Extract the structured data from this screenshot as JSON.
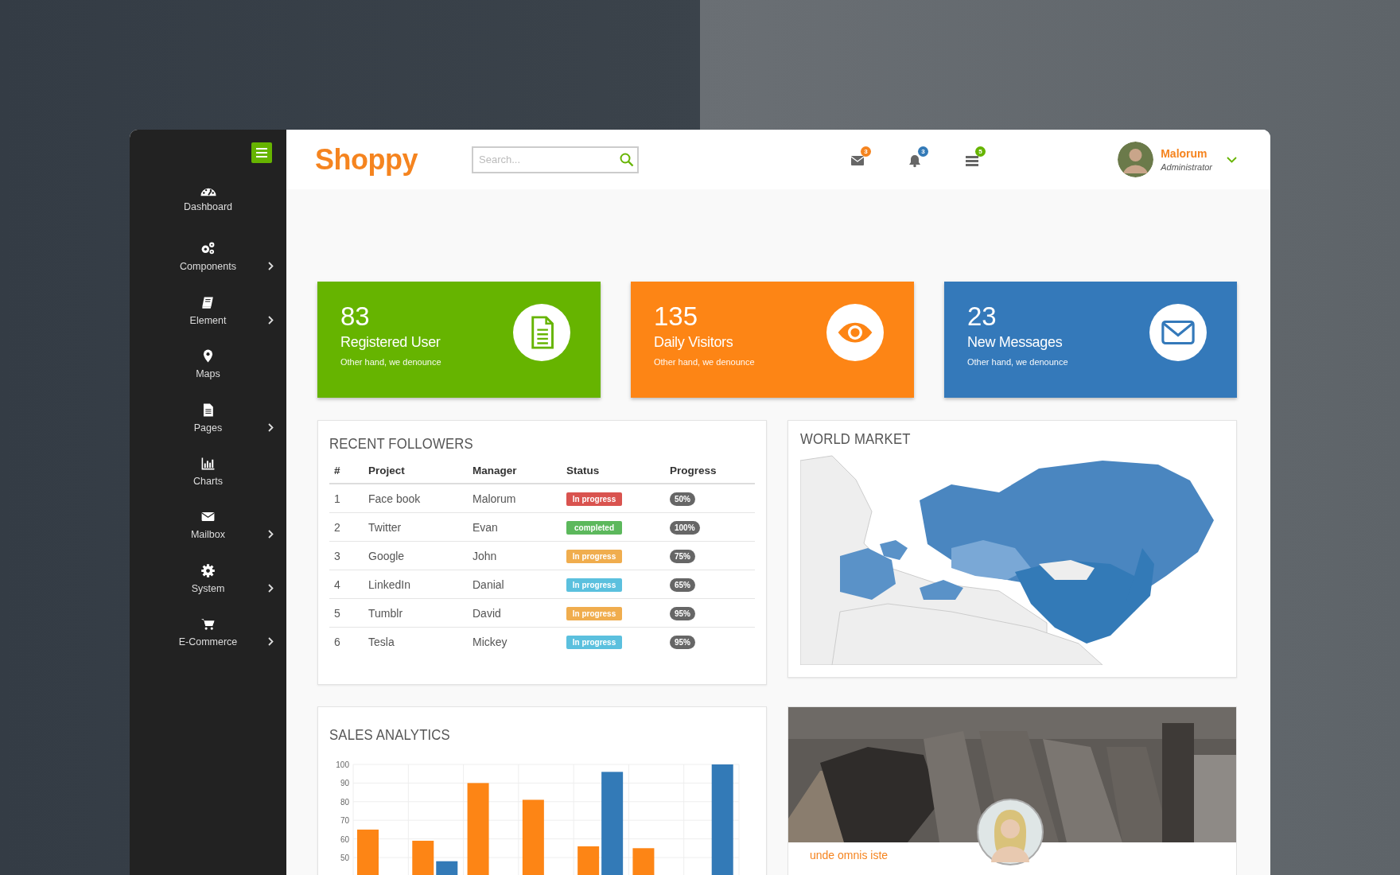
{
  "sidebar": {
    "items": [
      {
        "label": "Dashboard",
        "expandable": false
      },
      {
        "label": "Components",
        "expandable": true
      },
      {
        "label": "Element",
        "expandable": true
      },
      {
        "label": "Maps",
        "expandable": false
      },
      {
        "label": "Pages",
        "expandable": true
      },
      {
        "label": "Charts",
        "expandable": false
      },
      {
        "label": "Mailbox",
        "expandable": true
      },
      {
        "label": "System",
        "expandable": true
      },
      {
        "label": "E-Commerce",
        "expandable": true
      }
    ]
  },
  "header": {
    "logo": "Shoppy",
    "search": {
      "placeholder": "Search..."
    },
    "notifications": [
      {
        "count": "3",
        "color": "#f5841f"
      },
      {
        "count": "3",
        "color": "#337ab7"
      },
      {
        "count": "5",
        "color": "#66b400"
      }
    ],
    "user": {
      "name": "Malorum",
      "role": "Administrator"
    }
  },
  "stats": [
    {
      "value": "83",
      "label": "Registered User",
      "note": "Other hand, we denounce",
      "color": "#66b400"
    },
    {
      "value": "135",
      "label": "Daily Visitors",
      "note": "Other hand, we denounce",
      "color": "#fd8515"
    },
    {
      "value": "23",
      "label": "New Messages",
      "note": "Other hand, we denounce",
      "color": "#3479ba"
    }
  ],
  "followers": {
    "title": "RECENT FOLLOWERS",
    "columns": [
      "#",
      "Project",
      "Manager",
      "Status",
      "Progress"
    ],
    "rows": [
      {
        "number": "1",
        "project": "Face book",
        "manager": "Malorum",
        "status": "In progress",
        "color": "#d9534f",
        "progress": "50%"
      },
      {
        "number": "2",
        "project": "Twitter",
        "manager": "Evan",
        "status": "completed",
        "color": "#5cb85c",
        "progress": "100%"
      },
      {
        "number": "3",
        "project": "Google",
        "manager": "John",
        "status": "In progress",
        "color": "#f0ad4e",
        "progress": "75%"
      },
      {
        "number": "4",
        "project": "LinkedIn",
        "manager": "Danial",
        "status": "In progress",
        "color": "#5bc0de",
        "progress": "65%"
      },
      {
        "number": "5",
        "project": "Tumblr",
        "manager": "David",
        "status": "In progress",
        "color": "#f0ad4e",
        "progress": "95%"
      },
      {
        "number": "6",
        "project": "Tesla",
        "manager": "Mickey",
        "status": "In progress",
        "color": "#5bc0de",
        "progress": "95%"
      }
    ]
  },
  "world_market": {
    "title": "WORLD MARKET"
  },
  "sales": {
    "title": "SALES ANALYTICS",
    "chart_data": {
      "type": "bar",
      "ylim": [
        40,
        100
      ],
      "grid": true,
      "yticks": [
        50,
        60,
        70,
        80,
        90,
        100
      ],
      "series": [
        {
          "color": "#fd8515",
          "values": [
            65,
            59,
            90,
            81,
            56,
            55,
            null
          ]
        },
        {
          "color": "#337ab7",
          "values": [
            null,
            48,
            null,
            null,
            96,
            null,
            100
          ]
        }
      ]
    }
  },
  "profile": {
    "caption": "unde omnis iste"
  }
}
